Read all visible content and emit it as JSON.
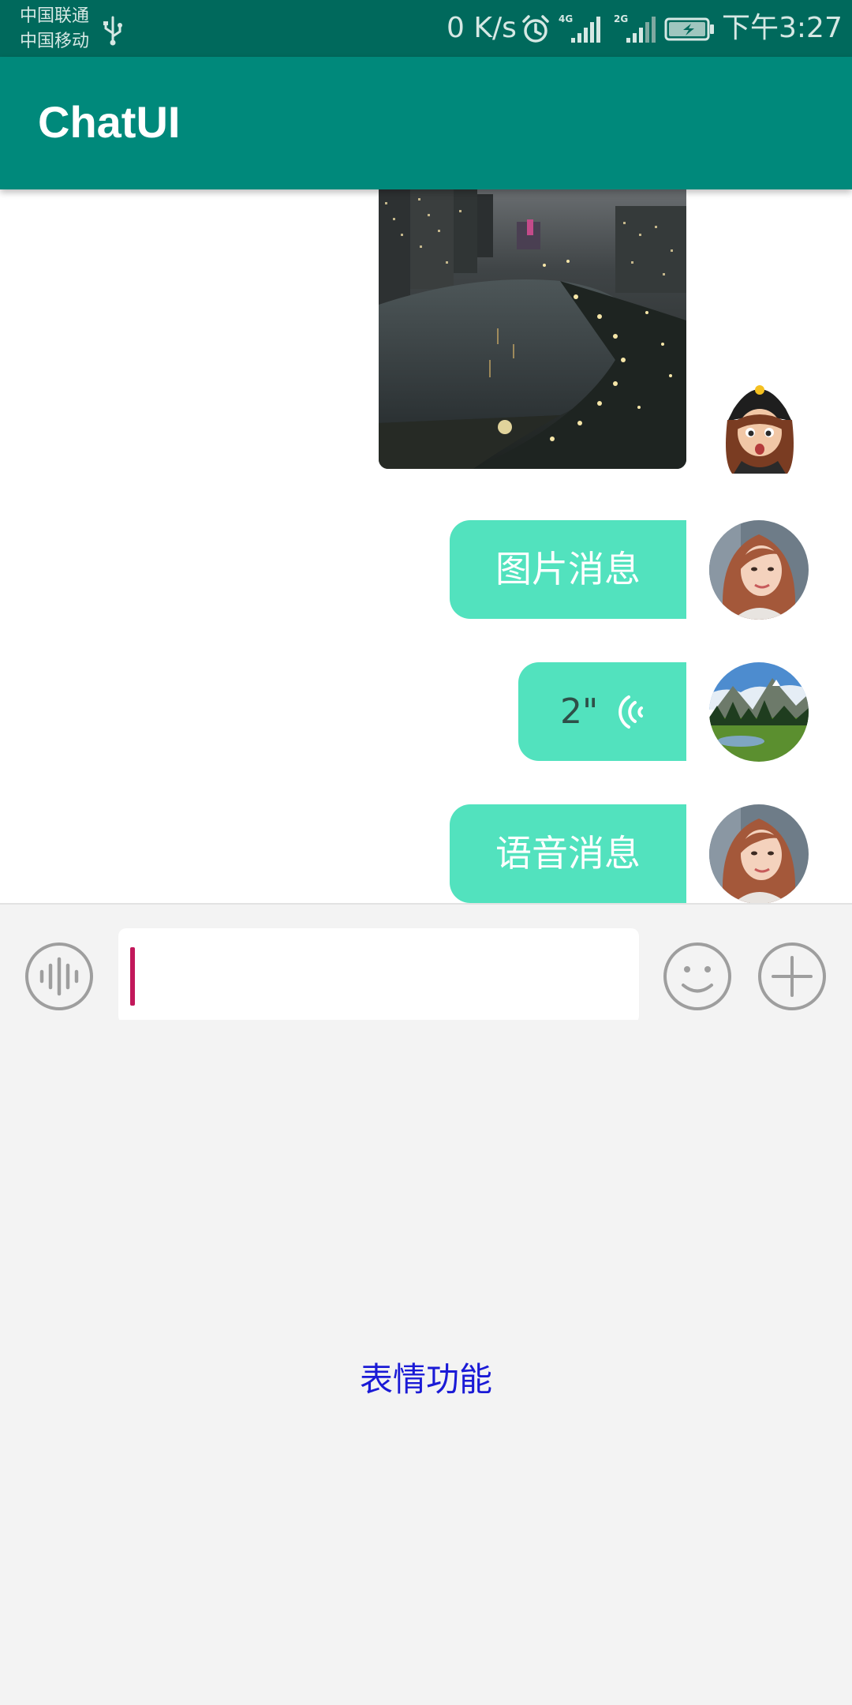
{
  "status_bar": {
    "carrier_1": "中国联通",
    "carrier_2": "中国移动",
    "net_speed": "0 K/s",
    "time": "下午3:27",
    "signal_1_label": "4G",
    "signal_2_label": "2G",
    "icons": [
      "usb-icon",
      "alarm-icon",
      "signal-4g-icon",
      "signal-2g-icon",
      "battery-charging-icon"
    ]
  },
  "app_bar": {
    "title": "ChatUI"
  },
  "messages": [
    {
      "type": "image",
      "sender_avatar": "cartoon-avatar"
    },
    {
      "type": "text",
      "text": "图片消息",
      "sender_avatar": "girl-avatar"
    },
    {
      "type": "voice",
      "duration": "2\"",
      "sender_avatar": "landscape-avatar"
    },
    {
      "type": "text",
      "text": "语音消息",
      "sender_avatar": "girl-avatar"
    }
  ],
  "input_bar": {
    "value": "",
    "placeholder": "",
    "icons": [
      "voice-wave-icon",
      "emoji-smile-icon",
      "plus-circle-icon"
    ]
  },
  "emoji_panel": {
    "label": "表情功能"
  },
  "colors": {
    "status_bar": "#00695c",
    "app_bar": "#00897b",
    "bubble": "#52e2be",
    "panel_label": "#1a1ad6",
    "cursor": "#c2185b"
  }
}
